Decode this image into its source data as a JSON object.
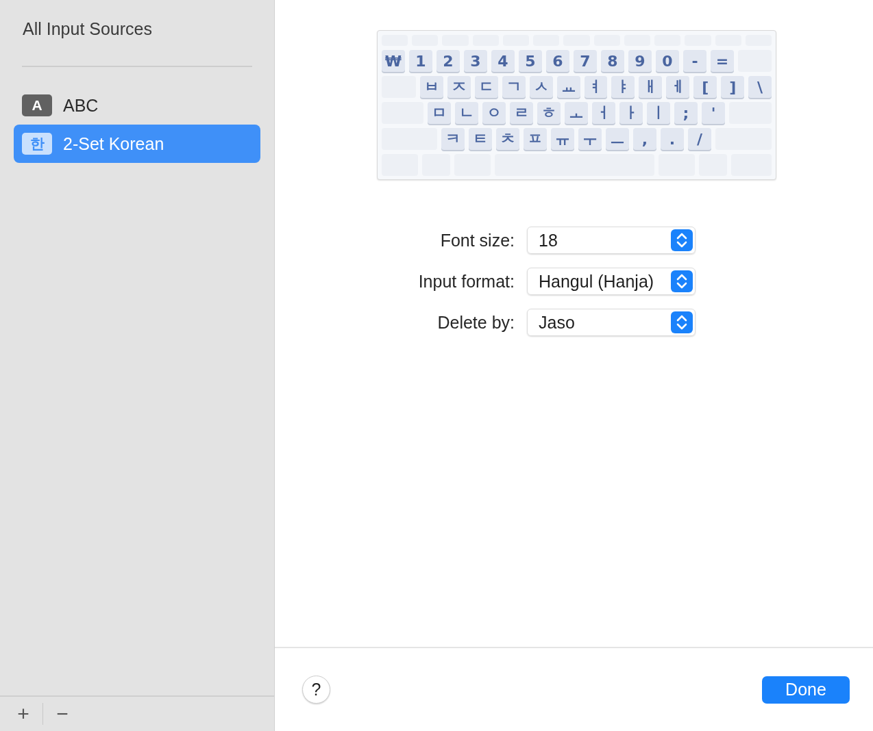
{
  "sidebar": {
    "title": "All Input Sources",
    "items": [
      {
        "badge": "A",
        "label": "ABC",
        "selected": false
      },
      {
        "badge": "한",
        "label": "2-Set Korean",
        "selected": true
      }
    ],
    "add_button": "+",
    "remove_button": "−"
  },
  "keyboard": {
    "rows": [
      [
        "₩",
        "1",
        "2",
        "3",
        "4",
        "5",
        "6",
        "7",
        "8",
        "9",
        "0",
        "-",
        "="
      ],
      [
        "ㅂ",
        "ㅈ",
        "ㄷ",
        "ㄱ",
        "ㅅ",
        "ㅛ",
        "ㅕ",
        "ㅑ",
        "ㅐ",
        "ㅔ",
        "[",
        "]",
        "\\"
      ],
      [
        "ㅁ",
        "ㄴ",
        "ㅇ",
        "ㄹ",
        "ㅎ",
        "ㅗ",
        "ㅓ",
        "ㅏ",
        "ㅣ",
        ";",
        "'"
      ],
      [
        "ㅋ",
        "ㅌ",
        "ㅊ",
        "ㅍ",
        "ㅠ",
        "ㅜ",
        "ㅡ",
        ",",
        ".",
        "/"
      ]
    ]
  },
  "settings": [
    {
      "label": "Font size:",
      "value": "18"
    },
    {
      "label": "Input format:",
      "value": "Hangul (Hanja)"
    },
    {
      "label": "Delete by:",
      "value": "Jaso"
    }
  ],
  "help_button": "?",
  "done_button": "Done"
}
